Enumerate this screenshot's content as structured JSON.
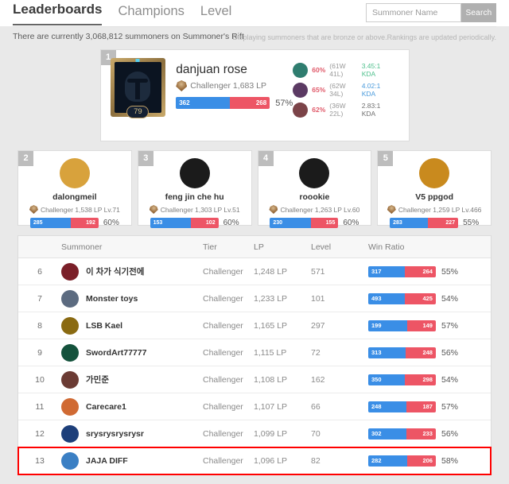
{
  "header": {
    "nav": [
      {
        "label": "Leaderboards",
        "active": true
      },
      {
        "label": "Champions",
        "active": false
      },
      {
        "label": "Level",
        "active": false
      }
    ],
    "search": {
      "placeholder": "Summoner Name",
      "value": "",
      "button_label": "Search"
    }
  },
  "subbar": {
    "summary": "There are currently 3,068,812 summoners on Summoner's Rift",
    "note": "Displaying summoners that are bronze or above.Rankings are updated periodically."
  },
  "colors": {
    "win_bar": "#3a8ee6",
    "loss_bar": "#ed5565",
    "highlight": "#ff0000",
    "page_bg": "#e9e9e9"
  },
  "top_player": {
    "rank": "1",
    "name": "danjuan rose",
    "tier": "Challenger",
    "lp": "1,683 LP",
    "tier_lp_text": "Challenger 1,683 LP",
    "level": "79",
    "wins": "362",
    "losses": "268",
    "win_ratio": "57%",
    "win_pct_num": 57,
    "champions": [
      {
        "win_rate": "60%",
        "record": "(61W 41L)",
        "kda": "3.45:1 KDA",
        "kda_color": "green",
        "avatar": "#2f7d6f"
      },
      {
        "win_rate": "65%",
        "record": "(62W 34L)",
        "kda": "4.02:1 KDA",
        "kda_color": "blue",
        "avatar": "#5b3a63"
      },
      {
        "win_rate": "62%",
        "record": "(36W 22L)",
        "kda": "2.83:1 KDA",
        "kda_color": "gray",
        "avatar": "#7b4348"
      }
    ]
  },
  "mini_players": [
    {
      "rank": "2",
      "name": "dalongmeil",
      "tier_text": "Challenger 1,538 LP Lv.71",
      "wins": "285",
      "losses": "192",
      "win_ratio": "60%",
      "win_pct_num": 60,
      "avatar": "#d8a23c"
    },
    {
      "rank": "3",
      "name": "feng jin che hu",
      "tier_text": "Challenger 1,303 LP Lv.51",
      "wins": "153",
      "losses": "102",
      "win_ratio": "60%",
      "win_pct_num": 60,
      "avatar": "#1b1b1b"
    },
    {
      "rank": "4",
      "name": "roookie",
      "tier_text": "Challenger 1,263 LP Lv.60",
      "wins": "230",
      "losses": "155",
      "win_ratio": "60%",
      "win_pct_num": 60,
      "avatar": "#1b1b1b"
    },
    {
      "rank": "5",
      "name": "V5 ppgod",
      "tier_text": "Challenger 1,259 LP Lv.466",
      "wins": "283",
      "losses": "227",
      "win_ratio": "55%",
      "win_pct_num": 55,
      "avatar": "#c98a1e"
    }
  ],
  "table": {
    "columns": [
      "",
      "Summoner",
      "Tier",
      "LP",
      "Level",
      "Win Ratio"
    ],
    "rows": [
      {
        "rank": "6",
        "name": "이 차가 식기전에",
        "tier": "Challenger",
        "lp": "1,248 LP",
        "level": "571",
        "wins": "317",
        "losses": "264",
        "win_ratio": "55%",
        "win_pct_num": 55,
        "avatar": "#7a1f28",
        "highlight": false
      },
      {
        "rank": "7",
        "name": "Monster toys",
        "tier": "Challenger",
        "lp": "1,233 LP",
        "level": "101",
        "wins": "493",
        "losses": "425",
        "win_ratio": "54%",
        "win_pct_num": 54,
        "avatar": "#5c6b80",
        "highlight": false
      },
      {
        "rank": "8",
        "name": "LSB Kael",
        "tier": "Challenger",
        "lp": "1,165 LP",
        "level": "297",
        "wins": "199",
        "losses": "149",
        "win_ratio": "57%",
        "win_pct_num": 57,
        "avatar": "#8a6a12",
        "highlight": false
      },
      {
        "rank": "9",
        "name": "SwordArt77777",
        "tier": "Challenger",
        "lp": "1,115 LP",
        "level": "72",
        "wins": "313",
        "losses": "248",
        "win_ratio": "56%",
        "win_pct_num": 56,
        "avatar": "#14523c",
        "highlight": false
      },
      {
        "rank": "10",
        "name": "가민준",
        "tier": "Challenger",
        "lp": "1,108 LP",
        "level": "162",
        "wins": "350",
        "losses": "298",
        "win_ratio": "54%",
        "win_pct_num": 54,
        "avatar": "#6b3b34",
        "highlight": false
      },
      {
        "rank": "11",
        "name": "Carecare1",
        "tier": "Challenger",
        "lp": "1,107 LP",
        "level": "66",
        "wins": "248",
        "losses": "187",
        "win_ratio": "57%",
        "win_pct_num": 57,
        "avatar": "#d06a33",
        "highlight": false
      },
      {
        "rank": "12",
        "name": "srysrysrysrysr",
        "tier": "Challenger",
        "lp": "1,099 LP",
        "level": "70",
        "wins": "302",
        "losses": "233",
        "win_ratio": "56%",
        "win_pct_num": 56,
        "avatar": "#1d3f7a",
        "highlight": false
      },
      {
        "rank": "13",
        "name": "JAJA DIFF",
        "tier": "Challenger",
        "lp": "1,096 LP",
        "level": "82",
        "wins": "282",
        "losses": "206",
        "win_ratio": "58%",
        "win_pct_num": 58,
        "avatar": "#3a7fc4",
        "highlight": true
      }
    ]
  }
}
